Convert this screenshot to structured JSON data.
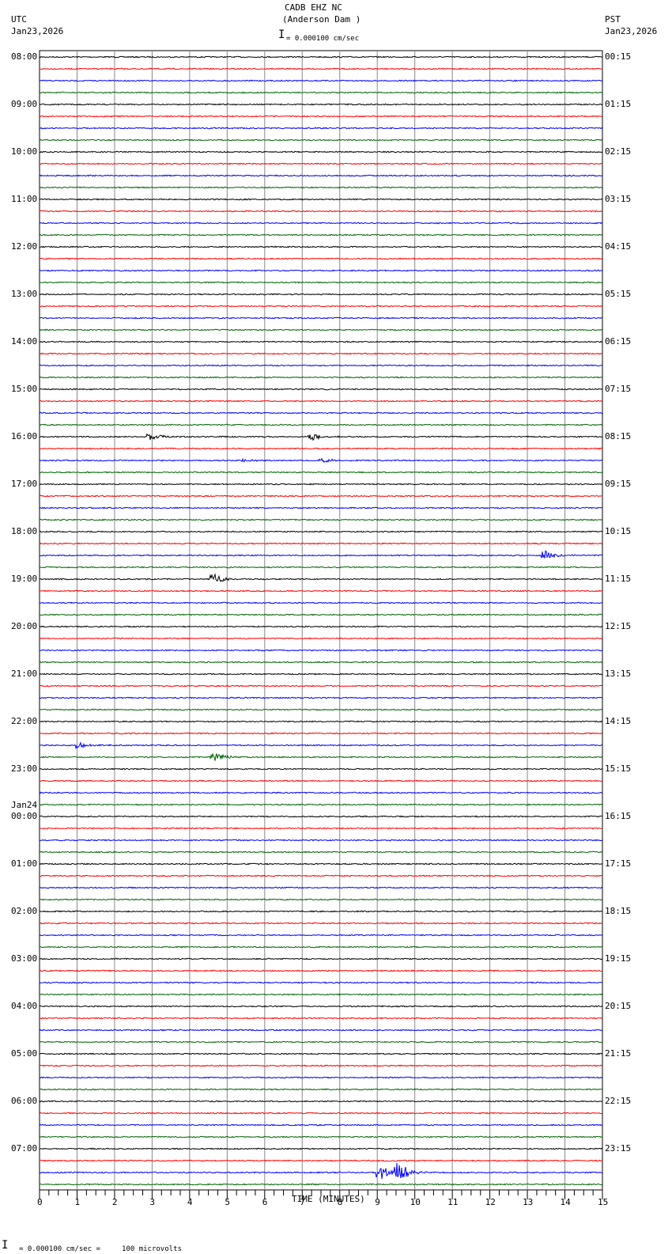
{
  "header": {
    "station": "CADB EHZ NC",
    "location": "(Anderson Dam )",
    "scale": "= 0.000100 cm/sec",
    "left_tz": "UTC",
    "left_date": "Jan23,2026",
    "right_tz": "PST",
    "right_date": "Jan23,2026"
  },
  "footer": {
    "scale_text": "= 0.000100 cm/sec =     100 microvolts"
  },
  "chart_data": {
    "type": "line",
    "title": "CADB EHZ NC (Anderson Dam )",
    "xlabel": "TIME (MINUTES)",
    "xlim": [
      0,
      15
    ],
    "x_ticks": [
      "0",
      "1",
      "2",
      "3",
      "4",
      "5",
      "6",
      "7",
      "8",
      "9",
      "10",
      "11",
      "12",
      "13",
      "14",
      "15"
    ],
    "traces_per_hour": 4,
    "trace_colors": [
      "#000000",
      "#ff0000",
      "#0000ff",
      "#006400"
    ],
    "left_labels": [
      "08:00",
      "09:00",
      "10:00",
      "11:00",
      "12:00",
      "13:00",
      "14:00",
      "15:00",
      "16:00",
      "17:00",
      "18:00",
      "19:00",
      "20:00",
      "21:00",
      "22:00",
      "23:00",
      "00:00",
      "01:00",
      "02:00",
      "03:00",
      "04:00",
      "05:00",
      "06:00",
      "07:00"
    ],
    "date_change_label": {
      "text": "Jan24",
      "before_hour_index": 16
    },
    "right_labels": [
      "00:15",
      "01:15",
      "02:15",
      "03:15",
      "04:15",
      "05:15",
      "06:15",
      "07:15",
      "08:15",
      "09:15",
      "10:15",
      "11:15",
      "12:15",
      "13:15",
      "14:15",
      "15:15",
      "16:15",
      "17:15",
      "18:15",
      "19:15",
      "20:15",
      "21:15",
      "22:15",
      "23:15"
    ],
    "events": [
      {
        "trace": 32,
        "minute": 3.0,
        "amplitude": 0.6
      },
      {
        "trace": 32,
        "minute": 7.3,
        "amplitude": 0.6
      },
      {
        "trace": 34,
        "minute": 5.5,
        "amplitude": 0.3
      },
      {
        "trace": 34,
        "minute": 7.6,
        "amplitude": 0.3
      },
      {
        "trace": 42,
        "minute": 13.5,
        "amplitude": 0.9
      },
      {
        "trace": 44,
        "minute": 4.7,
        "amplitude": 0.8
      },
      {
        "trace": 58,
        "minute": 1.1,
        "amplitude": 0.5
      },
      {
        "trace": 59,
        "minute": 4.7,
        "amplitude": 0.9
      },
      {
        "trace": 94,
        "minute": 9.1,
        "amplitude": 1.3
      },
      {
        "trace": 94,
        "minute": 9.6,
        "amplitude": 1.6
      }
    ]
  }
}
